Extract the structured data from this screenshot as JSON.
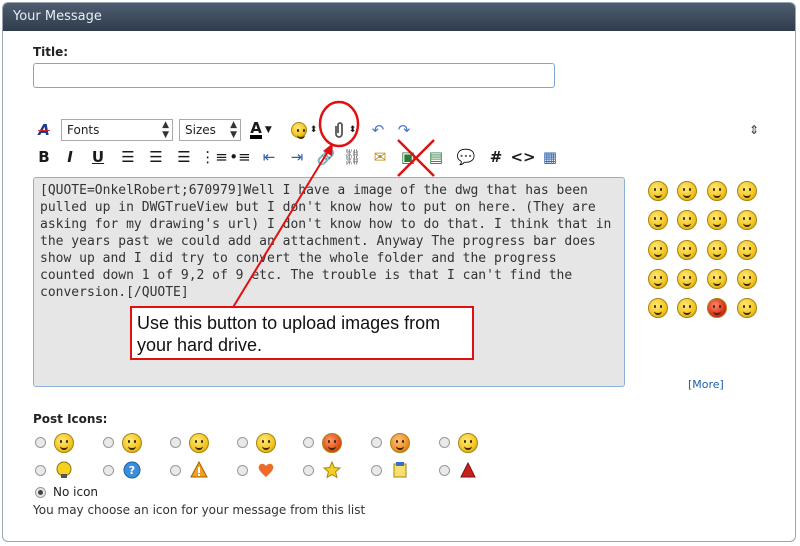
{
  "header": {
    "title": "Your Message"
  },
  "form": {
    "title_label": "Title:",
    "title_value": "",
    "post_icons_label": "Post Icons:",
    "no_icon_label": "No icon",
    "help_text": "You may choose an icon for your message from this list"
  },
  "toolbar": {
    "font_label": "Fonts",
    "size_label": "Sizes",
    "bold": "B",
    "italic": "I",
    "underline": "U",
    "hash": "#",
    "code": "<>"
  },
  "editor": {
    "content": "[QUOTE=OnkelRobert;670979]Well I have a image of the dwg that has been pulled up in DWGTrueView but I don't know how to put on here. (They are asking for my drawing's url) I don't know how to do that. I think that in the years past we could add an attachment. Anyway The progress bar does show up and I did try to convert the whole folder and the progress counted down 1 of 9,2 of 9 etc. The trouble is that I can't find the conversion.[/QUOTE]"
  },
  "smilies": {
    "more_label": "[More]"
  },
  "annotation": {
    "text": "Use this button to upload images from your hard drive.",
    "color": "#e01010"
  },
  "colors": {
    "header_bg": "#3e4c5e",
    "editor_bg": "#e6e6e6",
    "link": "#1c5fa8"
  }
}
